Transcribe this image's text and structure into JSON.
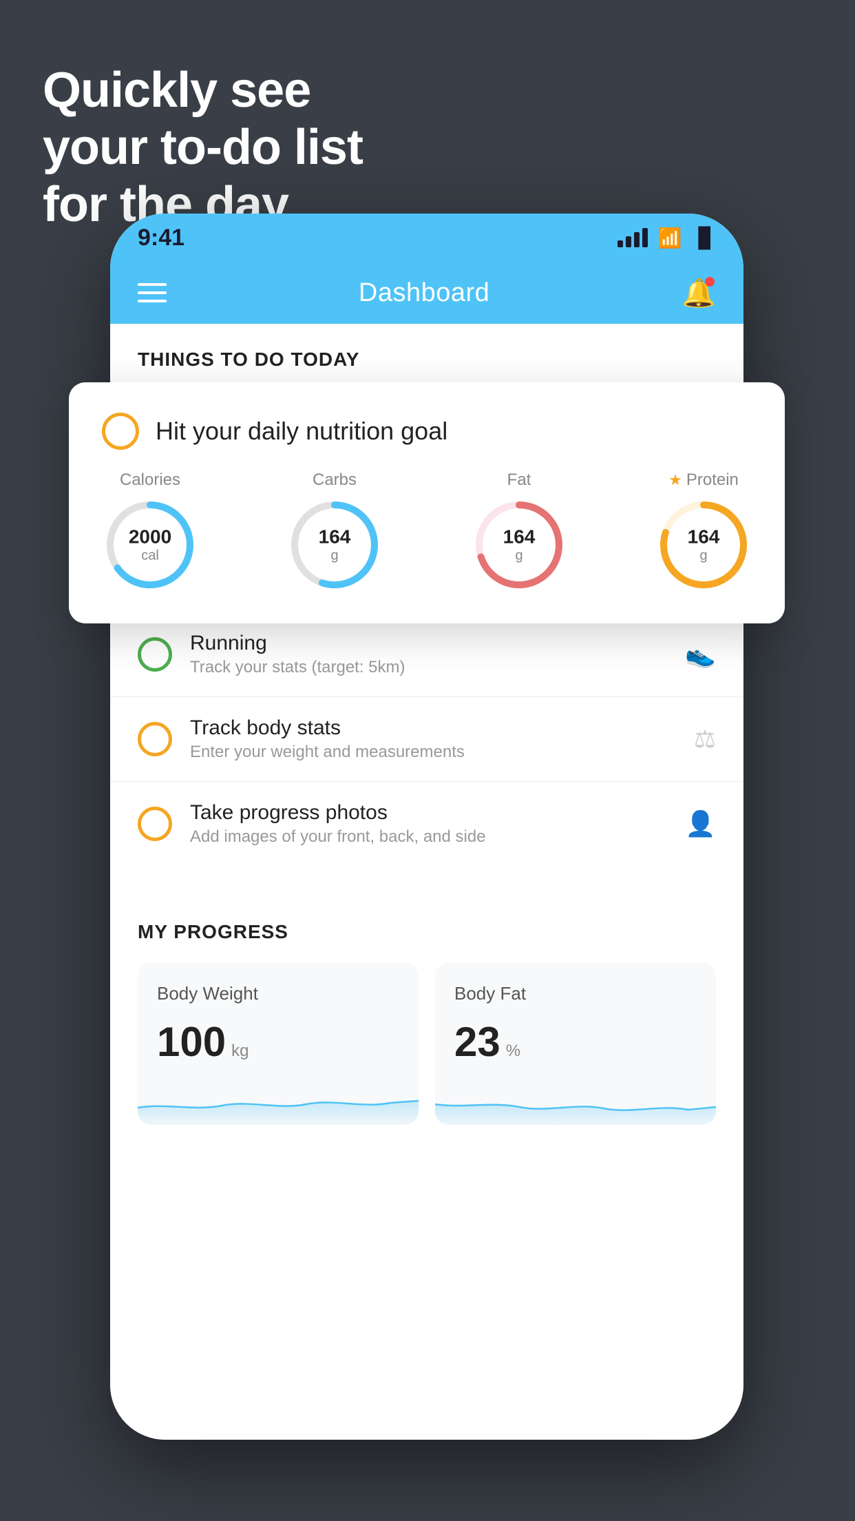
{
  "headline": {
    "line1": "Quickly see",
    "line2": "your to-do list",
    "line3": "for the day."
  },
  "status_bar": {
    "time": "9:41",
    "signal_label": "signal-bars",
    "wifi_label": "wifi-icon",
    "battery_label": "battery-icon"
  },
  "header": {
    "title": "Dashboard",
    "menu_label": "menu-icon",
    "bell_label": "bell-icon"
  },
  "things_today": {
    "section_title": "THINGS TO DO TODAY"
  },
  "nutrition_card": {
    "title": "Hit your daily nutrition goal",
    "items": [
      {
        "label": "Calories",
        "value": "2000",
        "unit": "cal",
        "color": "#4fc3f7",
        "track_color": "#e0e0e0",
        "percent": 65
      },
      {
        "label": "Carbs",
        "value": "164",
        "unit": "g",
        "color": "#4fc3f7",
        "track_color": "#e0e0e0",
        "percent": 55
      },
      {
        "label": "Fat",
        "value": "164",
        "unit": "g",
        "color": "#e57373",
        "track_color": "#fce4ec",
        "percent": 70
      },
      {
        "label": "Protein",
        "value": "164",
        "unit": "g",
        "color": "#f5a623",
        "track_color": "#fff3e0",
        "percent": 80,
        "starred": true
      }
    ]
  },
  "todo_items": [
    {
      "title": "Running",
      "subtitle": "Track your stats (target: 5km)",
      "circle_type": "green",
      "icon": "🏃"
    },
    {
      "title": "Track body stats",
      "subtitle": "Enter your weight and measurements",
      "circle_type": "orange",
      "icon": "⚖"
    },
    {
      "title": "Take progress photos",
      "subtitle": "Add images of your front, back, and side",
      "circle_type": "orange",
      "icon": "👤"
    }
  ],
  "progress": {
    "section_title": "MY PROGRESS",
    "cards": [
      {
        "title": "Body Weight",
        "value": "100",
        "unit": "kg"
      },
      {
        "title": "Body Fat",
        "value": "23",
        "unit": "%"
      }
    ]
  }
}
